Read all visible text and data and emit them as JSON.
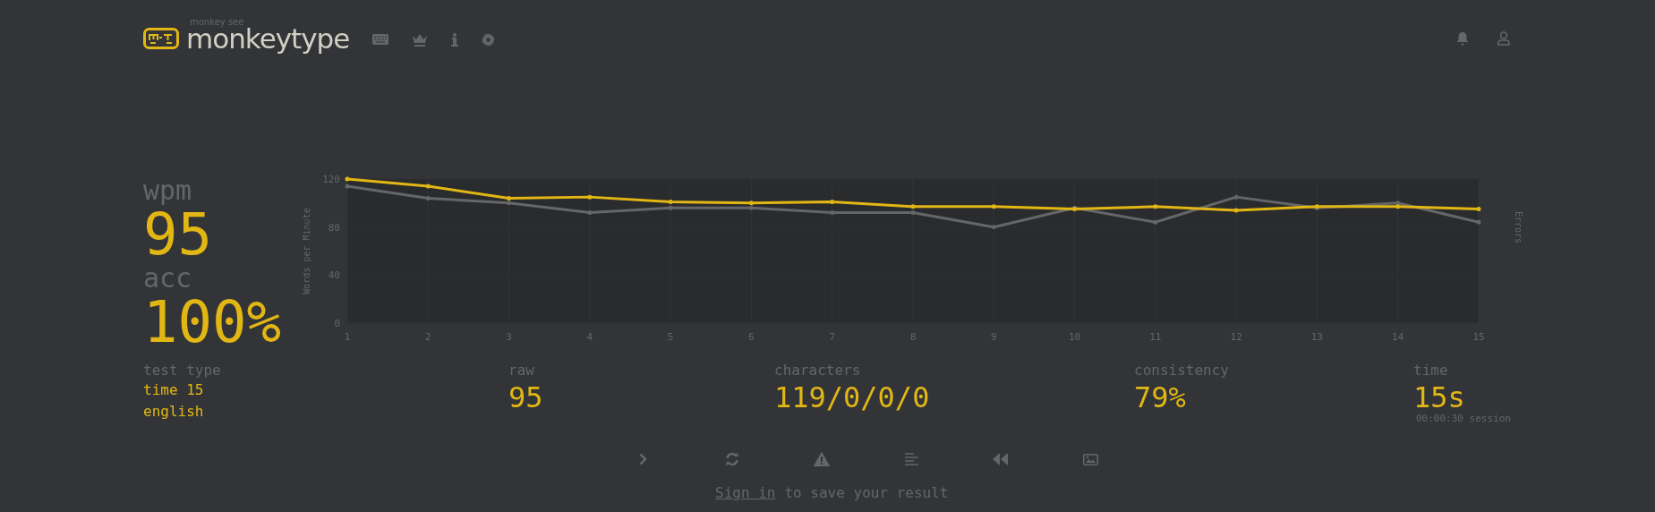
{
  "header": {
    "logo_subtitle": "monkey see",
    "logo_text": "monkeytype"
  },
  "result": {
    "wpm_label": "wpm",
    "wpm": "95",
    "acc_label": "acc",
    "acc": "100%"
  },
  "chart": {
    "chart_data": {
      "type": "line",
      "ylabel": "Words per Minute",
      "y2label": "Errors",
      "categories": [
        "1",
        "2",
        "3",
        "4",
        "5",
        "6",
        "7",
        "8",
        "9",
        "10",
        "11",
        "12",
        "13",
        "14",
        "15"
      ],
      "ylim": [
        0,
        120
      ],
      "grid": true,
      "yticks": [
        0,
        40,
        80,
        120
      ],
      "series": [
        {
          "color": "#e2b714",
          "values": [
            120,
            114,
            104,
            105,
            101,
            100,
            101,
            97,
            97,
            95,
            97,
            94,
            97,
            97,
            95
          ]
        },
        {
          "color": "#646669",
          "values": [
            114,
            104,
            100,
            92,
            96,
            96,
            92,
            92,
            80,
            96,
            84,
            105,
            96,
            100,
            84
          ]
        }
      ]
    }
  },
  "stats": [
    {
      "label": "test type",
      "values": [
        "time 15",
        "english"
      ],
      "kind": "small"
    },
    {
      "label": "raw",
      "values": [
        "95"
      ],
      "kind": "big"
    },
    {
      "label": "characters",
      "values": [
        "119/0/0/0"
      ],
      "kind": "big"
    },
    {
      "label": "consistency",
      "values": [
        "79%"
      ],
      "kind": "big"
    },
    {
      "label": "time",
      "values": [
        "15s"
      ],
      "kind": "big",
      "note": "00:00:30 session"
    }
  ],
  "sign_in": {
    "link": "Sign in",
    "text": "to save your result"
  }
}
